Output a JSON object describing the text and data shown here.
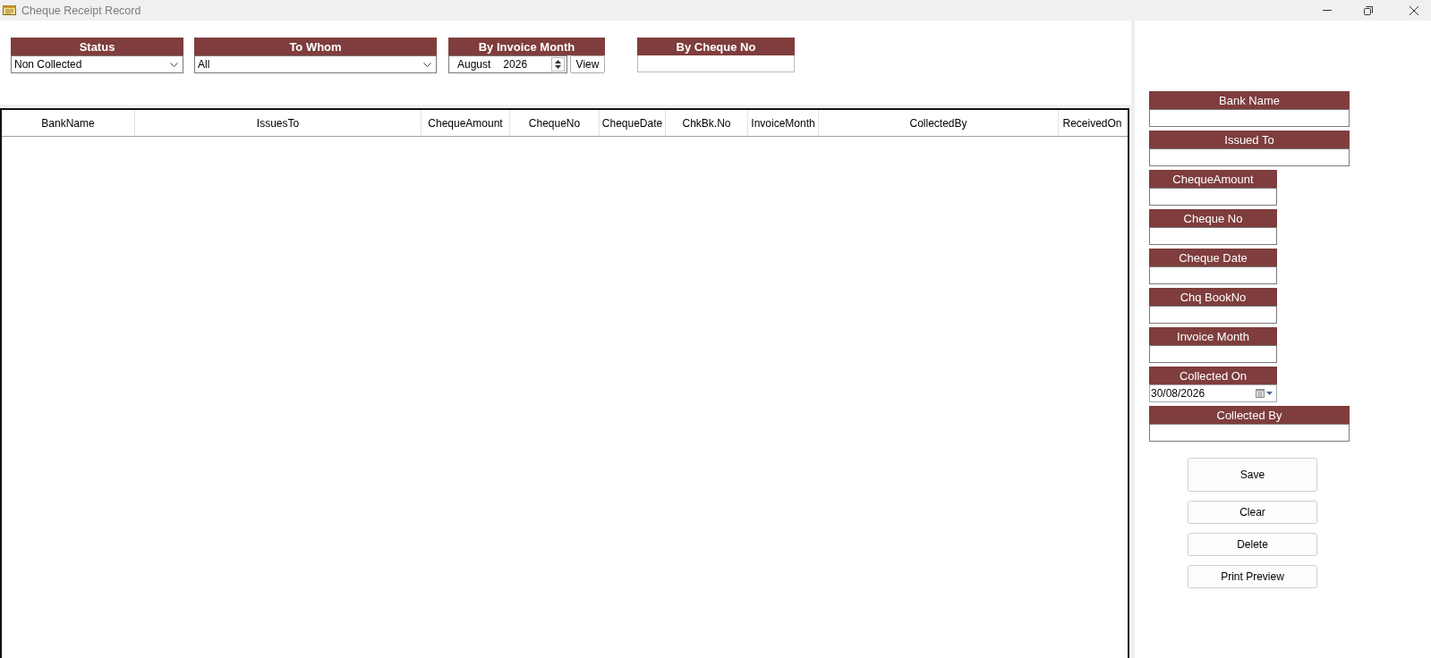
{
  "window": {
    "title": "Cheque Receipt Record"
  },
  "filters": [
    {
      "kind": "combo",
      "label": "Status",
      "value": "Non Collected"
    },
    {
      "kind": "combo",
      "label": "To Whom",
      "value": "All"
    },
    {
      "kind": "month",
      "label": "By Invoice Month",
      "month": "August",
      "year": "2026",
      "button": "View"
    },
    {
      "kind": "text",
      "label": "By Cheque No"
    }
  ],
  "table": {
    "columns": [
      "BankName",
      "IssuesTo",
      "ChequeAmount",
      "ChequeNo",
      "ChequeDate",
      "ChkBk.No",
      "InvoiceMonth",
      "CollectedBy",
      "ReceivedOn"
    ]
  },
  "form": {
    "fields": [
      {
        "kind": "text",
        "label": "Bank Name"
      },
      {
        "kind": "text",
        "label": "Issued To"
      },
      {
        "kind": "text",
        "label": "ChequeAmount"
      },
      {
        "kind": "text",
        "label": "Cheque No"
      },
      {
        "kind": "text",
        "label": "Cheque Date"
      },
      {
        "kind": "text",
        "label": "Chq BookNo"
      },
      {
        "kind": "text",
        "label": "Invoice Month"
      },
      {
        "kind": "date",
        "label": "Collected On",
        "value": "30/08/2026"
      },
      {
        "kind": "text",
        "label": "Collected By"
      }
    ],
    "buttons": [
      "Save",
      "Clear",
      "Delete",
      "Print Preview"
    ]
  }
}
